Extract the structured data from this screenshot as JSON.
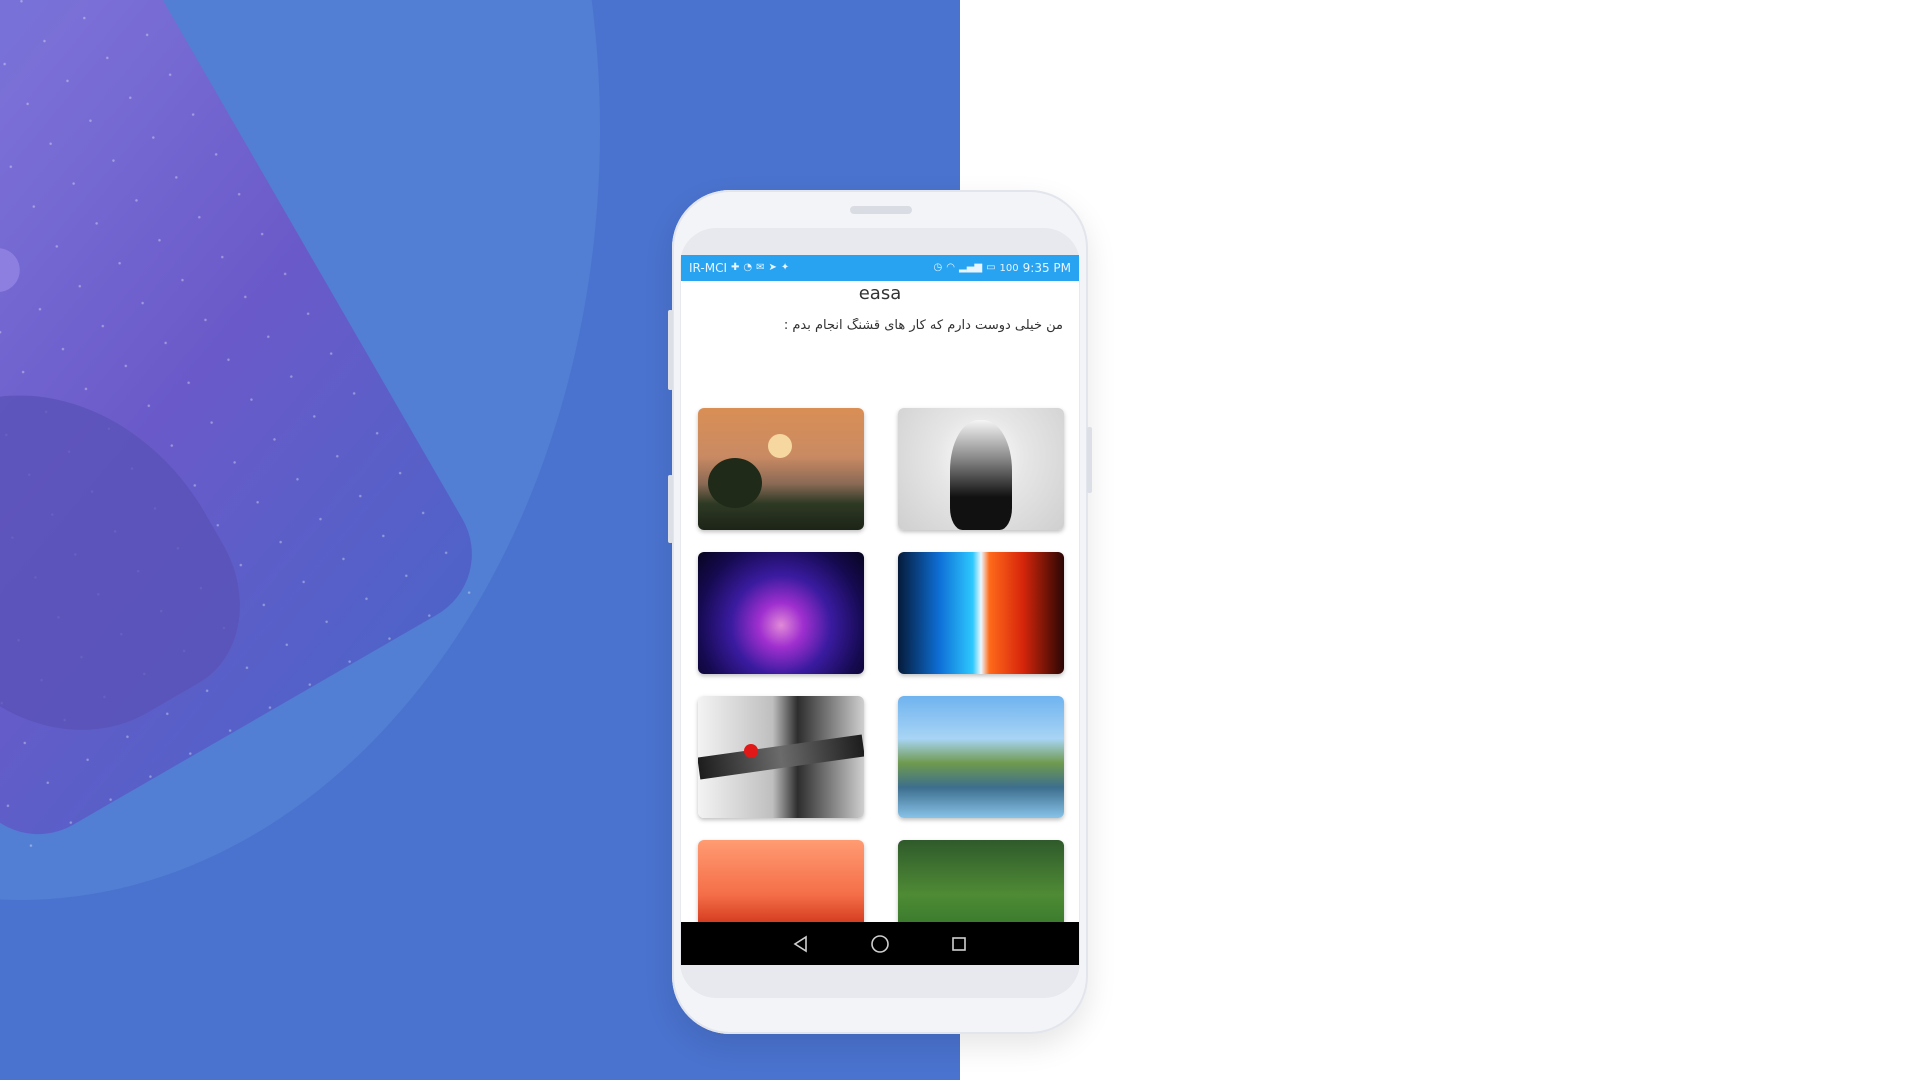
{
  "status_bar": {
    "carrier": "IR-MCI",
    "battery": "100",
    "time": "9:35 PM",
    "color": "#27a3f1"
  },
  "app": {
    "title": "easa",
    "bio": "من خیلی دوست دارم که کار های قشنگ انجام بدم :"
  },
  "gallery": {
    "items": [
      {
        "icon": "landscape-sunset-image"
      },
      {
        "icon": "head-silhouette-image"
      },
      {
        "icon": "nebula-image"
      },
      {
        "icon": "fire-ice-spheres-image"
      },
      {
        "icon": "sword-image"
      },
      {
        "icon": "floating-islands-image"
      },
      {
        "icon": "red-mountains-image"
      },
      {
        "icon": "green-valley-image"
      }
    ]
  },
  "nav": {
    "back": "back-icon",
    "home": "home-icon",
    "recents": "recents-icon"
  },
  "colors": {
    "background_blue": "#4a73cf",
    "screen_bg": "#ffffff"
  }
}
